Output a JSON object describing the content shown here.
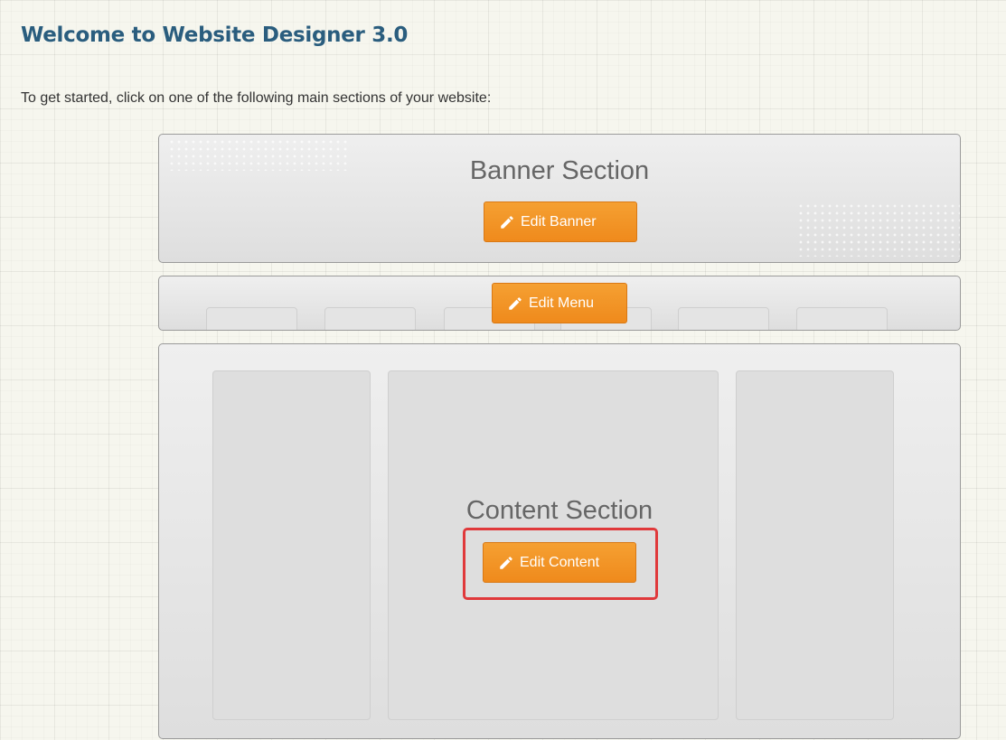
{
  "page": {
    "title": "Welcome to Website Designer 3.0",
    "intro": "To get started, click on one of the following main sections of your website:"
  },
  "banner": {
    "heading": "Banner Section",
    "button_label": "Edit Banner"
  },
  "menu": {
    "button_label": "Edit Menu"
  },
  "content": {
    "heading": "Content Section",
    "button_label": "Edit Content"
  },
  "colors": {
    "accent": "#f0901f",
    "title": "#2a5d7e",
    "highlight": "#e0393b"
  },
  "icons": {
    "edit": "pencil-icon"
  }
}
